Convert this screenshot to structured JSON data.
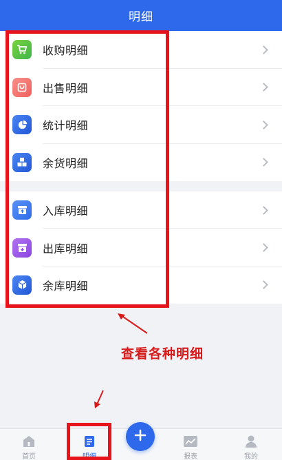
{
  "header": {
    "title": "明细"
  },
  "group1": [
    {
      "label": "收购明细",
      "icon": "cart-icon",
      "color": "#5cc03a"
    },
    {
      "label": "出售明细",
      "icon": "bag-icon",
      "color": "#f2706a"
    },
    {
      "label": "统计明细",
      "icon": "pie-chart-icon",
      "color": "#2e69ec"
    },
    {
      "label": "余货明细",
      "icon": "boxes-icon",
      "color": "#2e69ec"
    }
  ],
  "group2": [
    {
      "label": "入库明细",
      "icon": "inbound-icon",
      "color": "#3f7cf0"
    },
    {
      "label": "出库明细",
      "icon": "outbound-icon",
      "color": "#9b57e6"
    },
    {
      "label": "余库明细",
      "icon": "cube-icon",
      "color": "#2e69ec"
    }
  ],
  "annotation": {
    "text": "查看各种明细",
    "color": "#d71a1a"
  },
  "tabbar": {
    "home": "首页",
    "details": "明细",
    "reports": "报表",
    "mine": "我的",
    "accent": "#2e69ec"
  }
}
